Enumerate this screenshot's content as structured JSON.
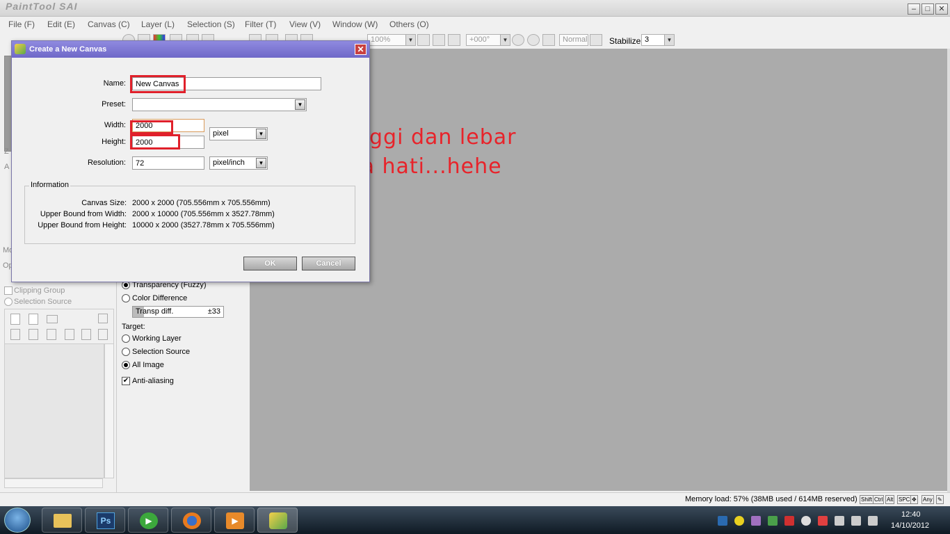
{
  "window": {
    "app_title": "PaintTool SAI",
    "min": "–",
    "max": "□",
    "close": "✕"
  },
  "menu": [
    "File (F)",
    "Edit (E)",
    "Canvas (C)",
    "Layer (L)",
    "Selection (S)",
    "Filter (T)",
    "View (V)",
    "Window (W)",
    "Others (O)"
  ],
  "toolbar": {
    "zoom": "100%",
    "rotation": "+000°",
    "blend": "Normal",
    "stabilizer_label": "Stabilizer",
    "stabilizer_value": "3"
  },
  "left_panel": {
    "labels": [
      "Z",
      "A",
      "Mo",
      "Op"
    ],
    "clipping_group": "Clipping Group",
    "selection_source": "Selection Source"
  },
  "mid_panel": {
    "mode_options": [
      "Transparency (Fuzzy)",
      "Color Difference"
    ],
    "transp_label": "Transp diff.",
    "transp_value": "±33",
    "target_label": "Target:",
    "target_options": [
      "Working Layer",
      "Selection Source",
      "All Image"
    ],
    "antialias": "Anti-aliasing"
  },
  "dialog": {
    "title": "Create a New Canvas",
    "name_label": "Name:",
    "name_value": "New Canvas",
    "preset_label": "Preset:",
    "preset_value": "",
    "width_label": "Width:",
    "width_value": "2000",
    "height_label": "Height:",
    "height_value": "2000",
    "unit": "pixel",
    "resolution_label": "Resolution:",
    "resolution_value": "72",
    "res_unit": "pixel/inch",
    "info_title": "Information",
    "info": [
      {
        "k": "Canvas Size:",
        "v": "2000 x 2000 (705.556mm x 705.556mm)"
      },
      {
        "k": "Upper Bound from Width:",
        "v": "2000 x 10000 (705.556mm x 3527.78mm)"
      },
      {
        "k": "Upper Bound from Height:",
        "v": "10000 x 2000 (3527.78mm x 705.556mm)"
      }
    ],
    "ok": "OK",
    "cancel": "Cancel"
  },
  "annotation": {
    "line1": "tukar tinggi dan lebar",
    "line2": "ikut suka hati...hehe"
  },
  "status": {
    "memory": "Memory load: 57% (38MB used / 614MB reserved)",
    "keys": [
      "Shift",
      "Ctrl",
      "Alt",
      "SPC",
      "✥",
      "Any",
      "✎"
    ]
  },
  "taskbar": {
    "time": "12:40",
    "date": "14/10/2012",
    "ps_label": "Ps"
  }
}
